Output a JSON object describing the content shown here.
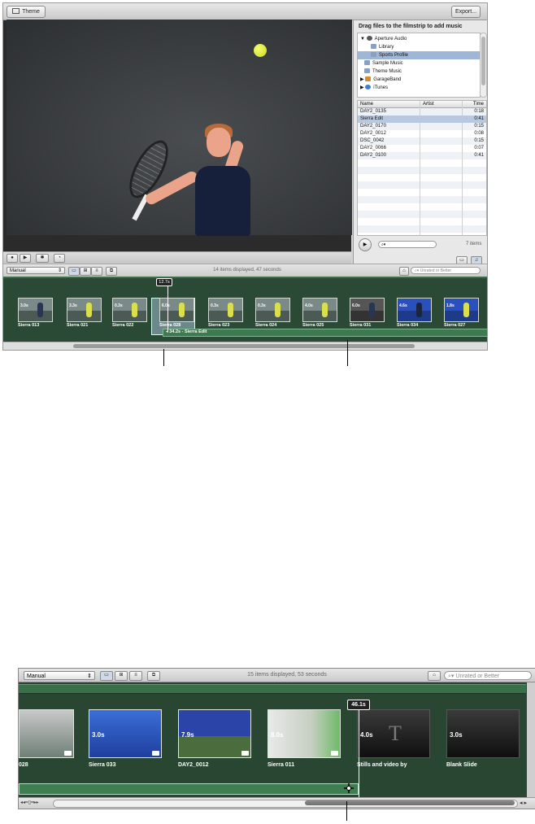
{
  "toolbar": {
    "theme_label": "Theme",
    "export_label": "Export..."
  },
  "music": {
    "drag_label": "Drag files to the filmstrip to add music",
    "sources": [
      {
        "label": "Aperture Audio",
        "selected": false
      },
      {
        "label": "Library",
        "selected": false
      },
      {
        "label": "Sports Profile",
        "selected": true
      },
      {
        "label": "Sample Music",
        "selected": false
      },
      {
        "label": "Theme Music",
        "selected": false
      },
      {
        "label": "GarageBand",
        "selected": false
      },
      {
        "label": "iTunes",
        "selected": false
      }
    ],
    "columns": {
      "name": "Name",
      "artist": "Artist",
      "time": "Time"
    },
    "tracks": [
      {
        "name": "DAY2_0135",
        "time": "0:18",
        "selected": false
      },
      {
        "name": "Sierra Edit",
        "time": "0:41",
        "selected": true
      },
      {
        "name": "DAY2_0170",
        "time": "0:15",
        "selected": false
      },
      {
        "name": "DAY2_0012",
        "time": "0:08",
        "selected": false
      },
      {
        "name": "DSC_0042",
        "time": "0:15",
        "selected": false
      },
      {
        "name": "DAY2_0066",
        "time": "0:07",
        "selected": false
      },
      {
        "name": "DAY2_0100",
        "time": "0:41",
        "selected": false
      }
    ],
    "count": "7 items"
  },
  "top_filter": {
    "sort": "Manual",
    "items_info": "14 items displayed, 47 seconds",
    "search_placeholder": "Unrated or Better"
  },
  "top_film": {
    "playhead": "12.7s",
    "music_label": "34.2s - Sierra Edit",
    "clips": [
      {
        "name": "Sierra 013",
        "dur": "3.0s"
      },
      {
        "name": "Sierra 021",
        "dur": "3.3s"
      },
      {
        "name": "Sierra 022",
        "dur": "0.3s"
      },
      {
        "name": "Sierra 028",
        "dur": "6.0s"
      },
      {
        "name": "Sierra 023",
        "dur": "0.3s"
      },
      {
        "name": "Sierra 024",
        "dur": "0.3s"
      },
      {
        "name": "Sierra 025",
        "dur": "4.0s"
      },
      {
        "name": "Sierra 031",
        "dur": "6.0s"
      },
      {
        "name": "Sierra 034",
        "dur": "4.6s"
      },
      {
        "name": "Sierra 027",
        "dur": "1.8s"
      }
    ]
  },
  "bottom": {
    "sort": "Manual",
    "items_info": "15 items displayed, 53 seconds",
    "search_placeholder": "Unrated or Better",
    "playhead": "46.1s",
    "clips": [
      {
        "name": "028",
        "dur": ""
      },
      {
        "name": "Sierra 033",
        "dur": "3.0s"
      },
      {
        "name": "DAY2_0012",
        "dur": "7.9s"
      },
      {
        "name": "Sierra 011",
        "dur": "8.0s"
      },
      {
        "name": "Stills and video by",
        "dur": "4.0s",
        "glyph": "T"
      },
      {
        "name": "Blank Slide",
        "dur": "3.0s"
      }
    ]
  }
}
